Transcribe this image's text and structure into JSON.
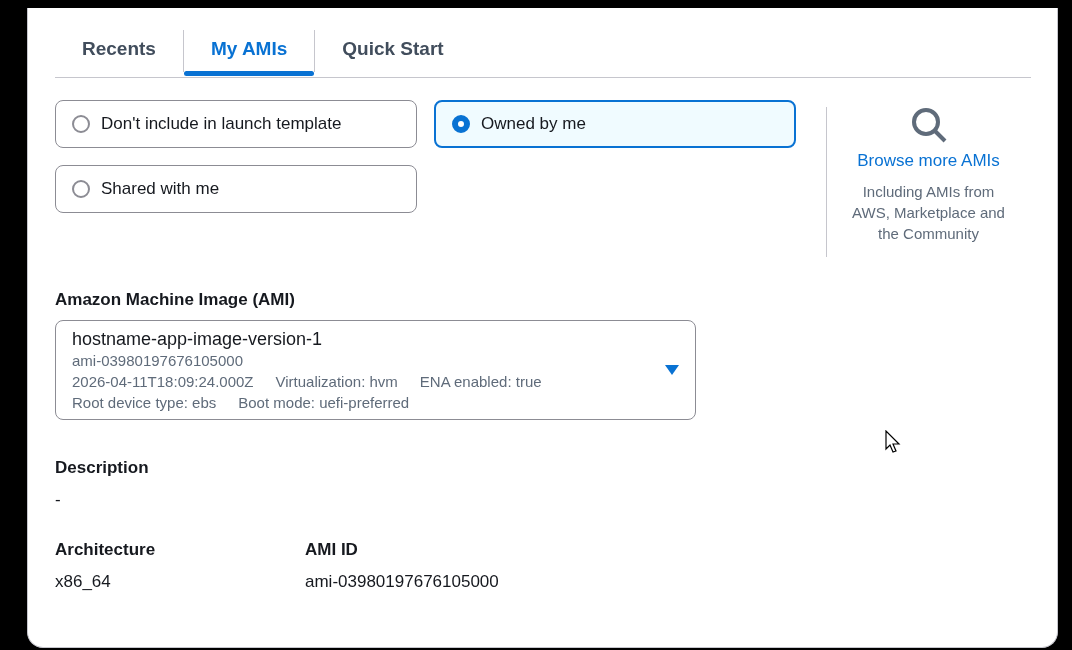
{
  "tabs": [
    {
      "label": "Recents",
      "selected": false
    },
    {
      "label": "My AMIs",
      "selected": true
    },
    {
      "label": "Quick Start",
      "selected": false
    }
  ],
  "options": [
    {
      "label": "Don't include in launch template",
      "selected": false
    },
    {
      "label": "Owned by me",
      "selected": true
    },
    {
      "label": "Shared with me",
      "selected": false
    }
  ],
  "browse": {
    "link": "Browse more AMIs",
    "caption": "Including AMIs from AWS, Marketplace and the Community"
  },
  "ami": {
    "label": "Amazon Machine Image (AMI)",
    "name": "hostname-app-image-version-1",
    "id": "ami-03980197676105000",
    "details": [
      [
        "2026-04-11T18:09:24.000Z",
        "Virtualization: hvm",
        "ENA enabled: true"
      ],
      [
        "Root device type: ebs",
        "Boot mode: uefi-preferred"
      ]
    ]
  },
  "description": {
    "label": "Description",
    "value": "-"
  },
  "fields": [
    {
      "label": "Architecture",
      "value": "x86_64"
    },
    {
      "label": "AMI ID",
      "value": "ami-03980197676105000"
    }
  ]
}
